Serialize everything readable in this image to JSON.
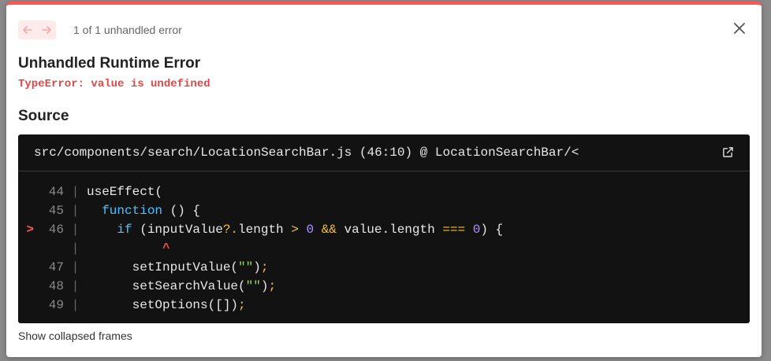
{
  "nav": {
    "prev_icon": "arrow-left-icon",
    "next_icon": "arrow-right-icon",
    "count_text": "1 of 1 unhandled error"
  },
  "error": {
    "title": "Unhandled Runtime Error",
    "message": "TypeError: value is undefined"
  },
  "source": {
    "heading": "Source",
    "file": "src/components/search/LocationSearchBar.js (46:10) @ LocationSearchBar/<",
    "lines": [
      {
        "marker": "",
        "num": "44",
        "code": "useEffect("
      },
      {
        "marker": "",
        "num": "45",
        "code": "  function () {"
      },
      {
        "marker": ">",
        "num": "46",
        "code": "    if (inputValue?.length > 0 && value.length === 0) {"
      },
      {
        "marker": "",
        "num": "",
        "code": "          ^"
      },
      {
        "marker": "",
        "num": "47",
        "code": "      setInputValue(\"\");"
      },
      {
        "marker": "",
        "num": "48",
        "code": "      setSearchValue(\"\");"
      },
      {
        "marker": "",
        "num": "49",
        "code": "      setOptions([]);"
      }
    ]
  },
  "collapsed_label": "Show collapsed frames",
  "colors": {
    "accent": "#ff5555",
    "error_text": "#e04848",
    "code_bg": "#121212",
    "keyword": "#4fc1ff",
    "operator": "#f0c040",
    "number": "#b294ff",
    "string": "#9ad46a"
  }
}
